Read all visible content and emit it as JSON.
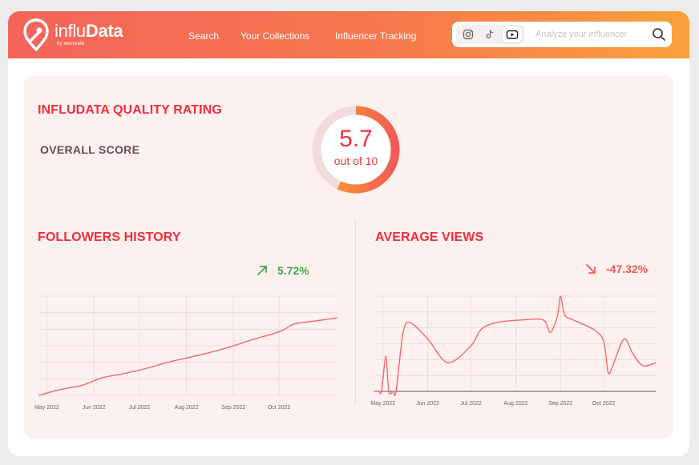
{
  "header": {
    "logo": {
      "brand_light": "influ",
      "brand_bold": "Data",
      "tagline": "by wecreate"
    },
    "nav": [
      {
        "label": "Search"
      },
      {
        "label": "Your Collections"
      },
      {
        "label": "Influencer Tracking"
      }
    ],
    "platforms": [
      {
        "name": "instagram-icon",
        "active": false
      },
      {
        "name": "tiktok-icon",
        "active": false
      },
      {
        "name": "youtube-icon",
        "active": true
      }
    ],
    "search": {
      "placeholder": "Analyze your influencer",
      "value": ""
    }
  },
  "quality": {
    "title": "INFLUDATA QUALITY RATING",
    "overall_label": "OVERALL SCORE",
    "score": "5.7",
    "score_sub": "out of 10",
    "score_value": 5.7,
    "score_max": 10
  },
  "followers": {
    "title": "FOLLOWERS HISTORY",
    "change": "5.72%",
    "trend": "up",
    "color": "#3fa64a"
  },
  "views": {
    "title": "AVERAGE VIEWS",
    "change": "-47.32%",
    "trend": "down",
    "color": "#f05a55"
  },
  "colors": {
    "accent_red": "#ef2f3b",
    "line": "#f26a6a",
    "gauge_orange": "#f7a72a",
    "gauge_red": "#f15a57"
  },
  "chart_data": [
    {
      "type": "line",
      "name": "followers-history",
      "x_ticks": [
        "May 2022",
        "Jun 2022",
        "Jul 2022",
        "Aug 2022",
        "Sep 2022",
        "Oct 2022"
      ],
      "x": [
        "2022-04-26",
        "2022-05-10",
        "2022-05-24",
        "2022-06-07",
        "2022-06-21",
        "2022-07-05",
        "2022-07-19",
        "2022-08-02",
        "2022-08-16",
        "2022-08-30",
        "2022-09-13",
        "2022-09-27",
        "2022-10-04",
        "2022-10-11",
        "2022-10-25",
        "2022-11-08"
      ],
      "y": [
        0,
        6,
        10,
        18,
        22,
        27,
        33,
        38,
        43,
        49,
        56,
        62,
        66,
        72,
        75,
        78
      ],
      "ylim": [
        0,
        100
      ],
      "grid": true
    },
    {
      "type": "line",
      "name": "average-views",
      "x_ticks": [
        "May 2022",
        "Jun 2022",
        "Jul 2022",
        "Aug 2022",
        "Sep 2022",
        "Oct 2022"
      ],
      "x": [
        "2022-04-25",
        "2022-04-28",
        "2022-04-30",
        "2022-05-03",
        "2022-05-05",
        "2022-05-08",
        "2022-05-10",
        "2022-05-15",
        "2022-05-20",
        "2022-06-01",
        "2022-06-15",
        "2022-07-01",
        "2022-07-08",
        "2022-07-18",
        "2022-08-05",
        "2022-08-20",
        "2022-08-25",
        "2022-08-30",
        "2022-09-01",
        "2022-09-04",
        "2022-09-10",
        "2022-09-25",
        "2022-10-01",
        "2022-10-04",
        "2022-10-07",
        "2022-10-15",
        "2022-10-21",
        "2022-10-28",
        "2022-11-06"
      ],
      "y": [
        0,
        0,
        0,
        37,
        0,
        0,
        0,
        62,
        72,
        55,
        30,
        48,
        65,
        72,
        75,
        75,
        62,
        80,
        100,
        80,
        75,
        64,
        52,
        20,
        26,
        55,
        40,
        27,
        30
      ],
      "ylim": [
        0,
        100
      ],
      "grid": true
    }
  ]
}
